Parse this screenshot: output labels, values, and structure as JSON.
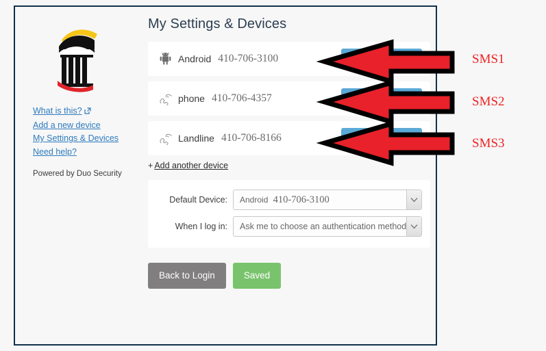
{
  "frame": {
    "border_color": "#12304a",
    "background": "#f7f7f7"
  },
  "sidebar": {
    "logo": {
      "name": "university-column-logo",
      "colors": {
        "column": "#111111",
        "top_arc": "#f5c518",
        "bottom_arc": "#e0242b"
      }
    },
    "links": [
      {
        "label": "What is this?",
        "icon": "external-link-icon",
        "has_external_icon": true
      },
      {
        "label": "Add a new device",
        "has_external_icon": false
      },
      {
        "label": "My Settings & Devices",
        "has_external_icon": false
      },
      {
        "label": "Need help?",
        "has_external_icon": false
      }
    ],
    "powered_by": "Powered by Duo Security",
    "link_color": "#2e7bbd"
  },
  "main": {
    "title": "My Settings & Devices",
    "devices": [
      {
        "icon": "android-robot-icon",
        "name": "Android",
        "number": "410-706-3100"
      },
      {
        "icon": "phone-handset-icon",
        "name": "phone",
        "number": "410-706-4357"
      },
      {
        "icon": "phone-handset-icon",
        "name": "Landline",
        "number": "410-706-8166"
      }
    ],
    "add_device": {
      "plus": "+",
      "label": "Add another device"
    },
    "settings": {
      "default_device": {
        "label": "Default Device:",
        "value_device": "Android",
        "value_number": "410-706-3100"
      },
      "when_i_log_in": {
        "label": "When I log in:",
        "value": "Ask me to choose an authentication method"
      }
    },
    "buttons": {
      "back": {
        "label": "Back to Login",
        "color": "#807e7e"
      },
      "saved": {
        "label": "Saved",
        "color": "#7ac36d"
      }
    },
    "device_action_color": "#5ba9d6"
  },
  "annotations": {
    "arrow_color": "#e8212a",
    "arrow_outline": "#000000",
    "label_color": "#ef2222",
    "items": [
      {
        "label": "SMS1"
      },
      {
        "label": "SMS2"
      },
      {
        "label": "SMS3"
      }
    ]
  }
}
